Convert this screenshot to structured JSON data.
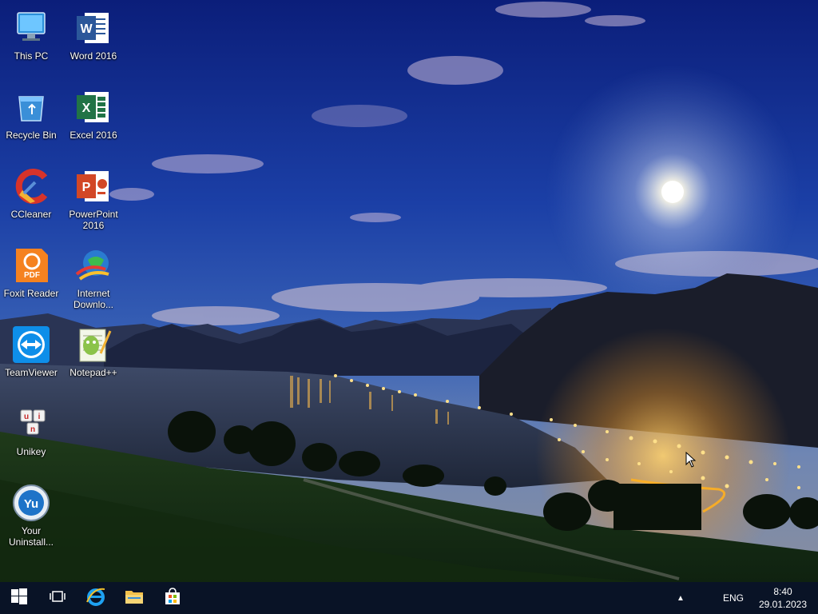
{
  "desktop": {
    "icons": [
      {
        "id": "this-pc",
        "label": "This PC",
        "icon": "computer-icon"
      },
      {
        "id": "word",
        "label": "Word 2016",
        "icon": "word-icon"
      },
      {
        "id": "recycle-bin",
        "label": "Recycle Bin",
        "icon": "recycle-bin-icon"
      },
      {
        "id": "excel",
        "label": "Excel 2016",
        "icon": "excel-icon"
      },
      {
        "id": "ccleaner",
        "label": "CCleaner",
        "icon": "ccleaner-icon"
      },
      {
        "id": "powerpoint",
        "label": "PowerPoint 2016",
        "icon": "powerpoint-icon"
      },
      {
        "id": "foxit",
        "label": "Foxit Reader",
        "icon": "foxit-pdf-icon"
      },
      {
        "id": "idm",
        "label": "Internet Downlo...",
        "icon": "internet-download-manager-icon"
      },
      {
        "id": "teamviewer",
        "label": "TeamViewer",
        "icon": "teamviewer-icon"
      },
      {
        "id": "notepadpp",
        "label": "Notepad++",
        "icon": "notepad-plus-plus-icon"
      },
      {
        "id": "unikey",
        "label": "Unikey",
        "icon": "unikey-icon"
      },
      {
        "id": "your-uninstaller",
        "label": "Your Uninstall...",
        "icon": "your-uninstaller-icon"
      }
    ]
  },
  "taskbar": {
    "pinned": [
      {
        "id": "start",
        "icon": "windows-start-icon"
      },
      {
        "id": "task-view",
        "icon": "task-view-icon"
      },
      {
        "id": "internet-explorer",
        "icon": "internet-explorer-icon"
      },
      {
        "id": "file-explorer",
        "icon": "folder-icon"
      },
      {
        "id": "store",
        "icon": "store-icon"
      }
    ],
    "tray": {
      "chevron": "▲",
      "language": "ENG",
      "time": "8:40",
      "date": "29.01.2023"
    }
  },
  "colors": {
    "taskbar_bg": "#0a1223",
    "word_blue": "#2b579a",
    "excel_green": "#217346",
    "ppt_orange": "#d24726",
    "teamviewer_blue": "#0e8ee9",
    "foxit_orange": "#f58220"
  }
}
